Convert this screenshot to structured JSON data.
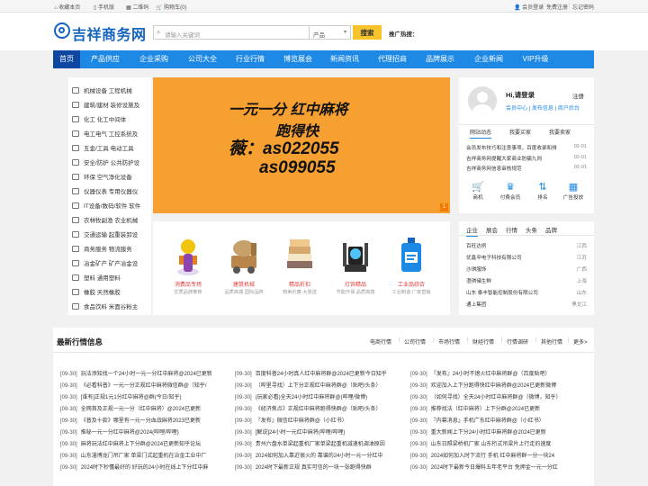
{
  "topbar": {
    "left": [
      "收藏本页",
      "手机版",
      "二维码",
      "购物车(0)"
    ],
    "right": [
      "会员登录",
      "免费注册",
      "忘记密码"
    ]
  },
  "header": {
    "logo": "吉祥商务网",
    "search_placeholder": "请输入关键词",
    "search_category": "产品",
    "search_button": "搜索",
    "hot_label": "推广热搜："
  },
  "nav": [
    "首页",
    "产品供应",
    "企业采购",
    "公司大全",
    "行业行情",
    "博览展会",
    "新闻资讯",
    "代理招商",
    "品牌展示",
    "企业新闻",
    "VIP升级"
  ],
  "categories": [
    {
      "label": "机械设备 工程机械"
    },
    {
      "label": "建筑/建材 装修设施及"
    },
    {
      "label": "化工 化工中间体"
    },
    {
      "label": "电工电气 工控系统及"
    },
    {
      "label": "五金/工具 电动工具"
    },
    {
      "label": "安全/防护 公共防护设"
    },
    {
      "label": "环保 空气净化设备"
    },
    {
      "label": "仪器仪表 专用仪器仪"
    },
    {
      "label": "IT设备/数码/软件 软件"
    },
    {
      "label": "农林牧副渔 农业机械"
    },
    {
      "label": "交通运输 起重装卸设"
    },
    {
      "label": "商务服务 物流服务"
    },
    {
      "label": "冶金矿产 矿产冶金设"
    },
    {
      "label": "塑料 通用塑料"
    },
    {
      "label": "橡胶 天然橡胶"
    },
    {
      "label": "食品饮料 米面谷粉主"
    }
  ],
  "banner": {
    "line1": "一元一分 红中麻将",
    "line2": "跑得快",
    "line3": "薇：as022055",
    "line4": "as099055",
    "page": "1"
  },
  "products": [
    {
      "title": "消费品专场",
      "sub": "优质品牌推荐"
    },
    {
      "title": "建筑机械",
      "sub": "品质高端 国际品牌"
    },
    {
      "title": "精品折扣",
      "sub": "物美价廉 大放送"
    },
    {
      "title": "灯饰精品",
      "sub": "节能环保 品质高端"
    },
    {
      "title": "工业品综合",
      "sub": "工业制造 厂家直销"
    }
  ],
  "user": {
    "greeting": "Hi,请登录",
    "register": "注册",
    "links": [
      "会员中心",
      "发布信息",
      "商户后台"
    ]
  },
  "user_tabs": [
    "网站动态",
    "我要买家",
    "我要卖家"
  ],
  "news": [
    {
      "title": "会员发布技巧和注意事项，百度收录和排",
      "date": "02-01"
    },
    {
      "title": "吉祥商务网提醒大家商业防骗九则",
      "date": "02-01"
    },
    {
      "title": "吉祥商务网信息审核规范",
      "date": "02-01"
    }
  ],
  "services": [
    {
      "icon": "cart-icon",
      "label": "商机"
    },
    {
      "icon": "vip-icon",
      "label": "付费会员"
    },
    {
      "icon": "ranking-icon",
      "label": "排名"
    },
    {
      "icon": "ad-icon",
      "label": "广告投放"
    }
  ],
  "company_tabs": [
    "企业",
    "展会",
    "行情",
    "头条",
    "品牌"
  ],
  "companies": [
    {
      "name": "百旺达例",
      "region": "江西"
    },
    {
      "name": "优鑫辛电子科技有限公司",
      "region": "江苏"
    },
    {
      "name": "沙琪服饰",
      "region": "广西"
    },
    {
      "name": "澄琪储生鲜",
      "region": "上海"
    },
    {
      "name": "山东 泰丰智能控制股份有限公司",
      "region": "山东"
    },
    {
      "name": "通上集团",
      "region": "黑龙江"
    }
  ],
  "market": {
    "title": "最新行情信息",
    "links": [
      "电商行情",
      "公司行情",
      "市场行情",
      "财经行情",
      "行情调研",
      "其他行情",
      "更多>"
    ],
    "rows": [
      [
        "[09-30]",
        "玩法添知找一个24小时一元一分红中麻将@2024已更新",
        "[09-30]",
        "百度科普24小时真人红中麻将群@2024已更新今日知乎",
        "[09-30]",
        "『发布』24小时不熄火红中麻将群@（百度贴吧）"
      ],
      [
        "[09-30]",
        "《必看科普》一元一分正规红中麻将微信群@（知乎/",
        "[09-30]",
        "（哔里寻找）上下分正规红中麻将群@（贴吧/头条）",
        "[09-30]",
        "欢迎加入上下分跑得快红中麻将群@2024已更新微博"
      ],
      [
        "[09-30]",
        "[谁有]正规1元1分红中麻将@群(今日/知乎)",
        "[09-30]",
        "(玩家必看)全天24小时红中麻将群@(哔哩/微博)",
        "[09-30]",
        "（如何寻找）全天24小时红中麻将群@（微博，知乎）"
      ],
      [
        "[09-30]",
        "全网首及正规一元一分（红中麻将）@2024已更新",
        "[09-30]",
        "《经济焦点》正规红中麻将跑得快群@（贴吧/头条）",
        "[09-30]",
        "推荐找法（红中麻将）上下分群@2024已更新"
      ],
      [
        "[09-30]",
        "《普及十款》哪里有一元一分血战麻将2023已更新",
        "[09-30]",
        "『发布』微信红中麻将群@（小红书）",
        "[09-30]",
        "『内幕消息』手机广东红中麻将群@（小红书）"
      ],
      [
        "[09-30]",
        "推秘一元一分红中麻将@2024(哔哩/哔哩)",
        "[09-30]",
        "[解说]24小时一元红中麻将(哔哩/哔哩)",
        "[09-30]",
        "重大新闻上下分24小时红中麻将群@2024已更新"
      ],
      [
        "[09-30]",
        "麻将玩法红中麻将上下分群@2024已更新知乎论坛",
        "[09-30]",
        "贵州六盘水单梁起重机厂家单梁起重机减速机调油原因",
        "[09-30]",
        "山东日照梁桥机厂家 山东桁式吊梁片上行走的速度"
      ],
      [
        "[09-30]",
        "山东淄博龙门吊厂家 单梁门式起重机在冶金工业中厂",
        "[09-30]",
        "2024如何加入靠近很火的 靠谱的24小时一元一分红中",
        "[09-30]",
        "2024如何加入时下流行 手机 红中麻将群一分一块24"
      ],
      [
        "[09-30]",
        "2024时下秒懂最好的 好玩的24小时在线上下分红中麻",
        "[09-30]",
        "2024时下最新正规 真实可信的一块一张跑得快群",
        "[09-30]",
        "2024时下最新今日爆料五年老平台 免押金一元一分红"
      ]
    ]
  },
  "colors": {
    "accent": "#1e88e5",
    "banner": "#f6a032",
    "search_button": "#f7c52b",
    "hot": "#e53935"
  }
}
